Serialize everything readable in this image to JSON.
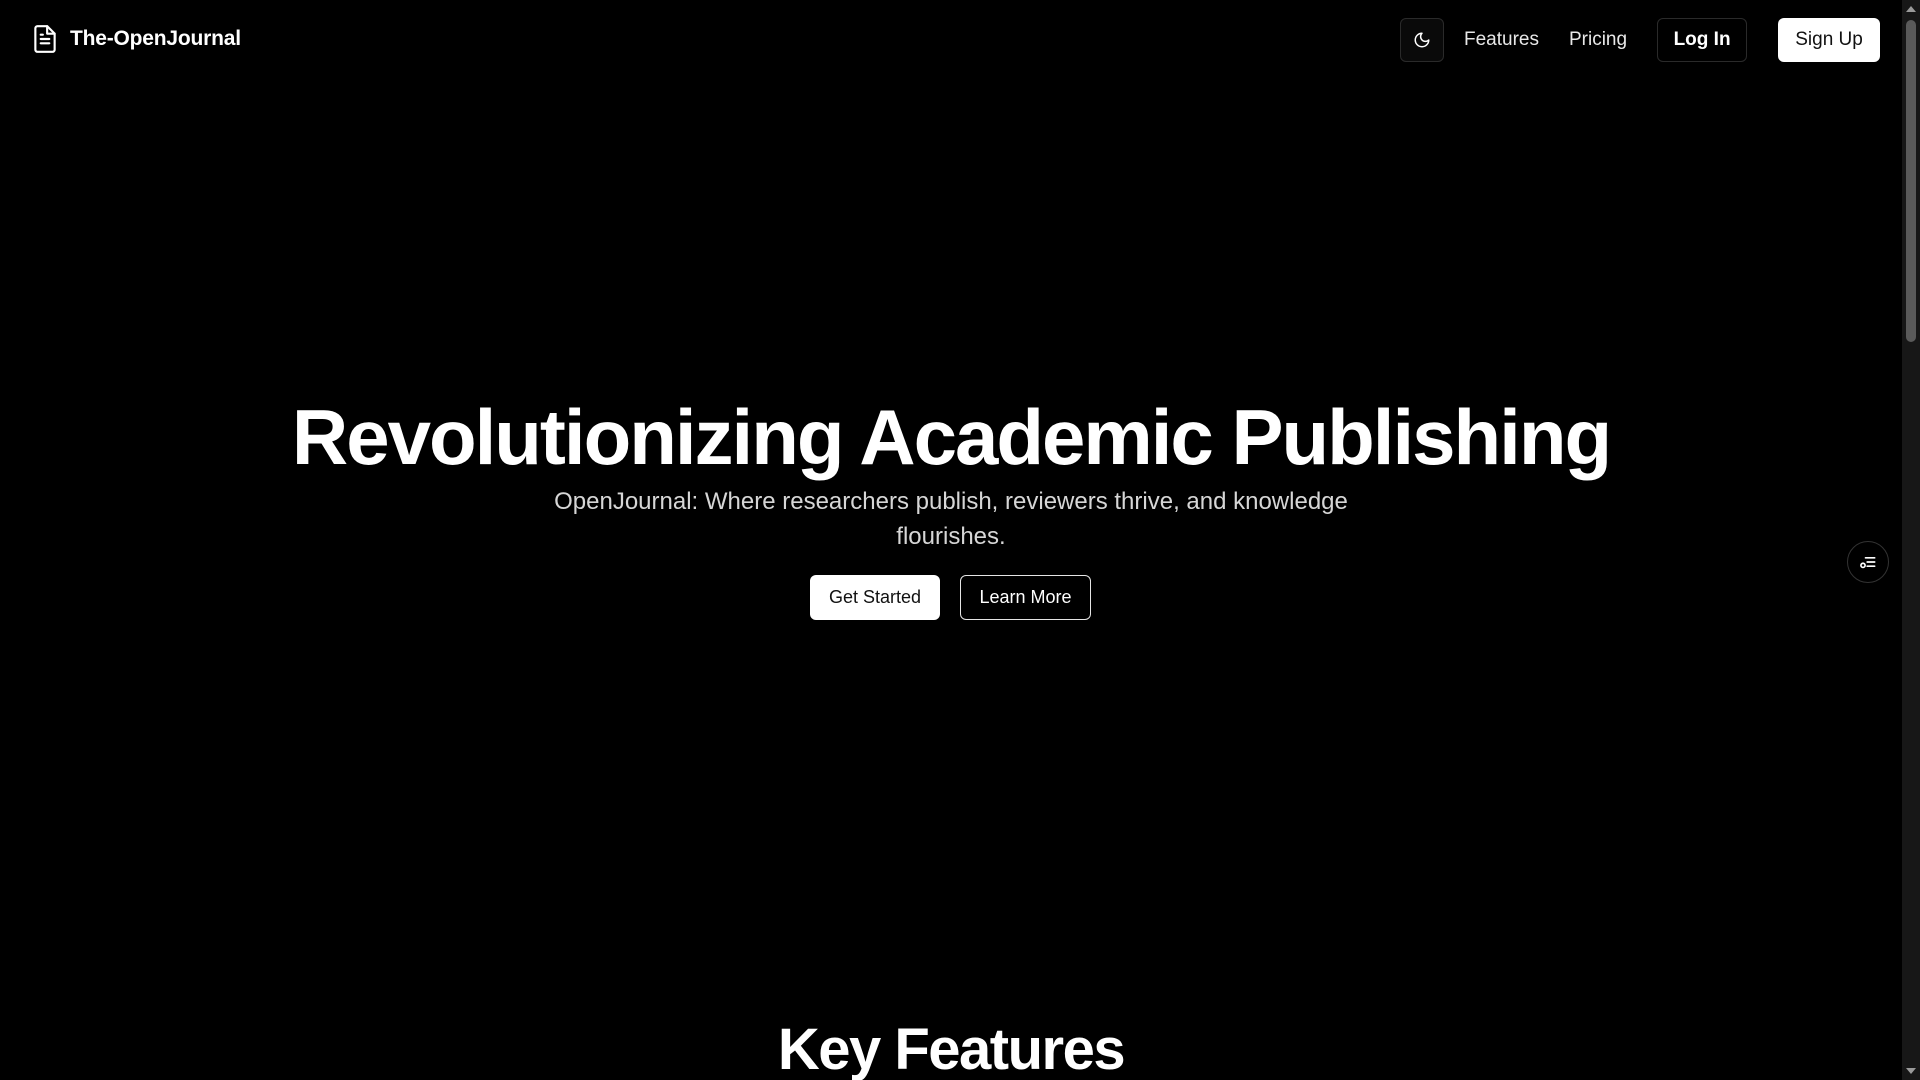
{
  "brand": {
    "name": "The-OpenJournal",
    "icon": "document-icon"
  },
  "nav": {
    "theme_toggle_icon": "moon-icon",
    "links": [
      {
        "label": "Features"
      },
      {
        "label": "Pricing"
      }
    ],
    "login_label": "Log In",
    "signup_label": "Sign Up"
  },
  "hero": {
    "title": "Revolutionizing Academic Publishing",
    "subtitle": "OpenJournal: Where researchers publish, reviewers thrive, and knowledge flourishes.",
    "primary_label": "Get Started",
    "secondary_label": "Learn More"
  },
  "floating": {
    "icon": "settings-list-icon"
  },
  "sections": {
    "features_title": "Key Features"
  },
  "colors": {
    "background": "#000000",
    "text": "#ffffff",
    "subtitle": "#d6d6d6",
    "button_light": "#ffffff"
  }
}
